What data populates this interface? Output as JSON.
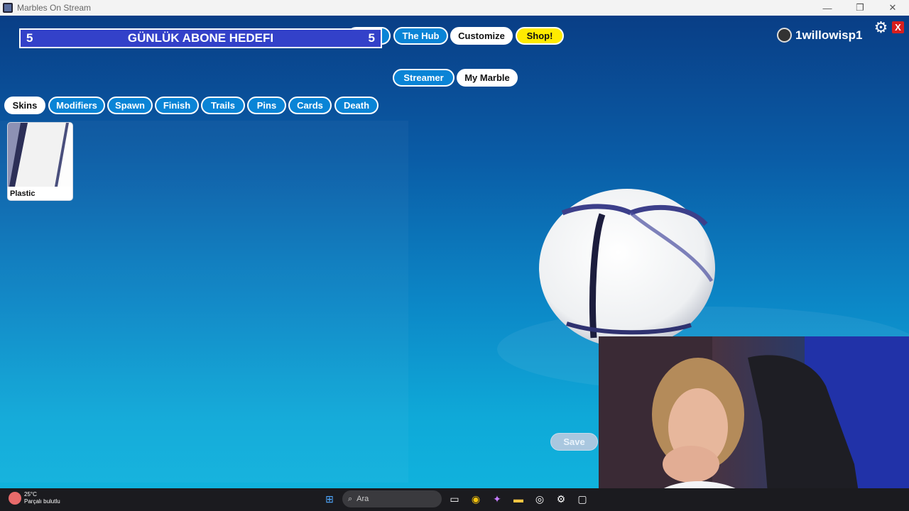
{
  "window": {
    "title": "Marbles On Stream",
    "controls": [
      "—",
      "❐",
      "✕"
    ]
  },
  "goal": {
    "left_count": "5",
    "title": "GÜNLÜK ABONE HEDEFI",
    "right_count": "5"
  },
  "top_nav": {
    "play": "Play",
    "hub": "The Hub",
    "customize": "Customize",
    "shop": "Shop!"
  },
  "user": {
    "name": "1willowisp1"
  },
  "close_label": "X",
  "mode_tabs": {
    "streamer": "Streamer",
    "my_marble": "My Marble"
  },
  "category_tabs": [
    "Skins",
    "Modifiers",
    "Spawn",
    "Finish",
    "Trails",
    "Pins",
    "Cards",
    "Death"
  ],
  "skins": [
    {
      "label": "Plastic"
    }
  ],
  "save_label": "Save",
  "taskbar": {
    "weather_temp": "25°C",
    "weather_desc": "Parçalı bulutlu",
    "search_placeholder": "Ara"
  },
  "colors": {
    "accent": "#0a84d6",
    "shop": "#ffeb00",
    "goal_bg": "#3341c9"
  }
}
